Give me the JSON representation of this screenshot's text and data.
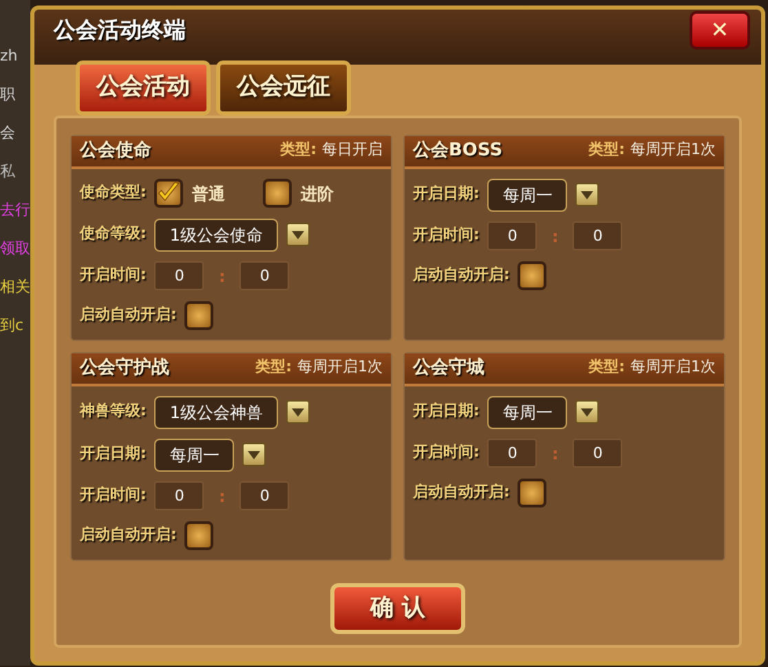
{
  "background_texts": [
    {
      "text": "zh",
      "color": "#d8d8d8"
    },
    {
      "text": "职",
      "color": "#d8d8d8"
    },
    {
      "text": "会",
      "color": "#d8d8d8"
    },
    {
      "text": "私",
      "color": "#bbbbbb"
    },
    {
      "text": "去行",
      "color": "#e040e0"
    },
    {
      "text": "领取",
      "color": "#e040e0"
    },
    {
      "text": "相关",
      "color": "#e8d040"
    },
    {
      "text": "到c",
      "color": "#e8d040"
    }
  ],
  "window": {
    "title": "公会活动终端",
    "close": "✕"
  },
  "tabs": [
    {
      "label": "公会活动",
      "selected": true
    },
    {
      "label": "公会远征",
      "selected": false
    }
  ],
  "sections": [
    {
      "title": "公会使命",
      "type_label": "类型:",
      "type_value": "每日开启",
      "fields": [
        {
          "kind": "options",
          "label": "使命类型:",
          "options": [
            {
              "label": "普通",
              "checked": true
            },
            {
              "label": "进阶",
              "checked": false
            }
          ]
        },
        {
          "kind": "dropdown",
          "label": "使命等级:",
          "value": "1级公会使命"
        },
        {
          "kind": "time",
          "label": "开启时间:",
          "hour": "0",
          "separator": ":",
          "minute": "0"
        },
        {
          "kind": "toggle",
          "label": "启动自动开启:",
          "checked": false
        }
      ]
    },
    {
      "title": "公会BOSS",
      "type_label": "类型:",
      "type_value": "每周开启1次",
      "fields": [
        {
          "kind": "dropdown",
          "label": "开启日期:",
          "value": "每周一"
        },
        {
          "kind": "time",
          "label": "开启时间:",
          "hour": "0",
          "separator": ":",
          "minute": "0"
        },
        {
          "kind": "toggle",
          "label": "启动自动开启:",
          "checked": false
        }
      ]
    },
    {
      "title": "公会守护战",
      "type_label": "类型:",
      "type_value": "每周开启1次",
      "fields": [
        {
          "kind": "dropdown",
          "label": "神兽等级:",
          "value": "1级公会神兽"
        },
        {
          "kind": "dropdown",
          "label": "开启日期:",
          "value": "每周一"
        },
        {
          "kind": "time",
          "label": "开启时间:",
          "hour": "0",
          "separator": ":",
          "minute": "0"
        },
        {
          "kind": "toggle",
          "label": "启动自动开启:",
          "checked": false
        }
      ]
    },
    {
      "title": "公会守城",
      "type_label": "类型:",
      "type_value": "每周开启1次",
      "fields": [
        {
          "kind": "dropdown",
          "label": "开启日期:",
          "value": "每周一"
        },
        {
          "kind": "time",
          "label": "开启时间:",
          "hour": "0",
          "separator": ":",
          "minute": "0"
        },
        {
          "kind": "toggle",
          "label": "启动自动开启:",
          "checked": false
        }
      ]
    }
  ],
  "confirm": "确 认"
}
